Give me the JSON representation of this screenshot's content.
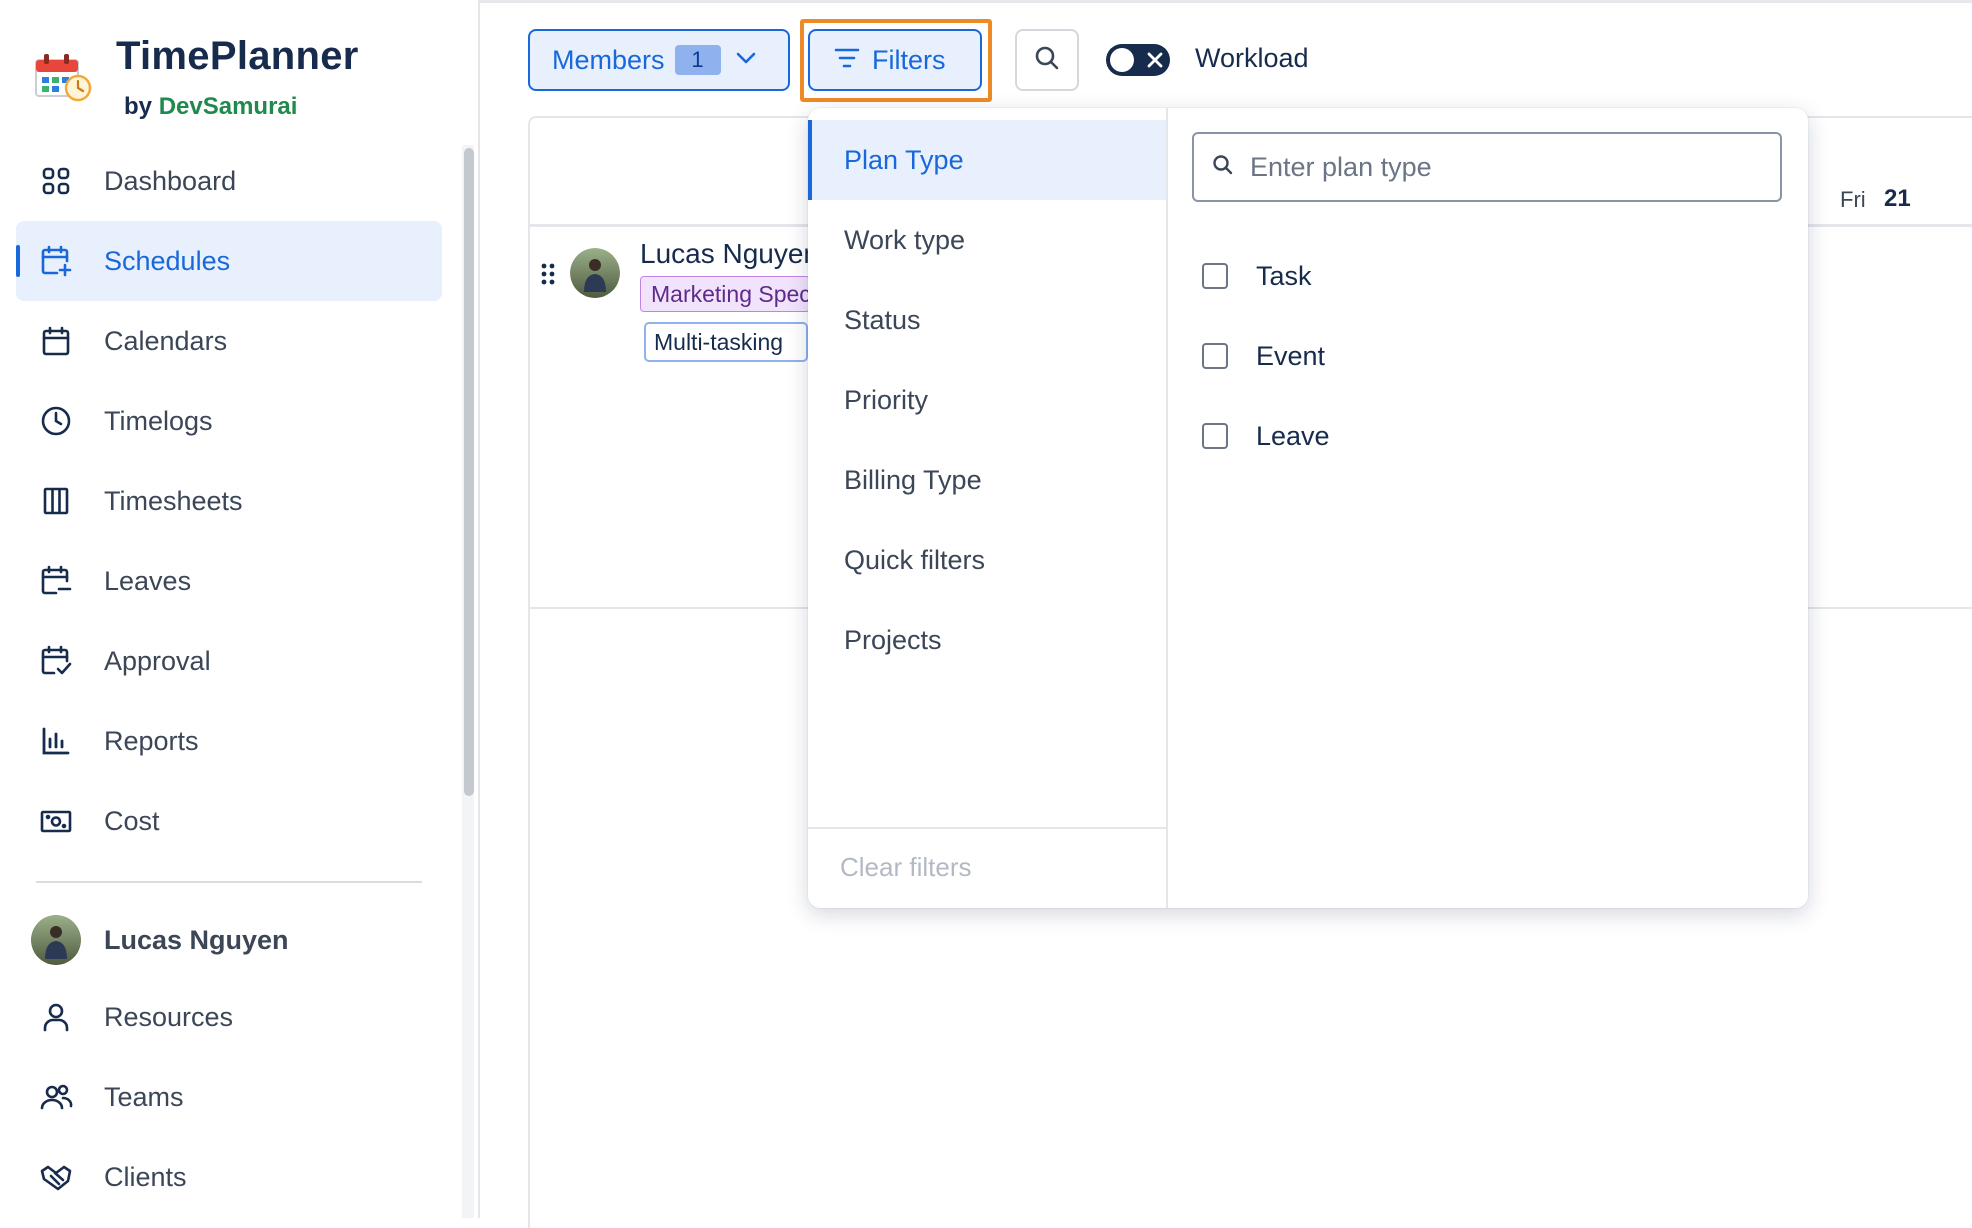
{
  "app": {
    "title": "TimePlanner",
    "by_prefix": "by",
    "brand": "DevSamurai"
  },
  "sidebar": {
    "items": [
      {
        "label": "Dashboard",
        "icon": "dashboard-icon"
      },
      {
        "label": "Schedules",
        "icon": "calendar-plus-icon",
        "active": true
      },
      {
        "label": "Calendars",
        "icon": "calendar-icon"
      },
      {
        "label": "Timelogs",
        "icon": "clock-icon"
      },
      {
        "label": "Timesheets",
        "icon": "columns-icon"
      },
      {
        "label": "Leaves",
        "icon": "calendar-minus-icon"
      },
      {
        "label": "Approval",
        "icon": "calendar-check-icon"
      },
      {
        "label": "Reports",
        "icon": "bar-chart-icon"
      },
      {
        "label": "Cost",
        "icon": "money-icon"
      }
    ],
    "user": {
      "name": "Lucas Nguyen"
    },
    "bottom_items": [
      {
        "label": "Resources",
        "icon": "person-icon"
      },
      {
        "label": "Teams",
        "icon": "team-icon"
      },
      {
        "label": "Clients",
        "icon": "handshake-icon"
      }
    ]
  },
  "toolbar": {
    "members_label": "Members",
    "members_count": "1",
    "filters_label": "Filters",
    "workload_label": "Workload",
    "workload_enabled": false
  },
  "schedule": {
    "day_label": "Fri",
    "day_number": "21",
    "member": {
      "name": "Lucas Nguyen",
      "role_tag": "Marketing Specialist",
      "skill_tag": "Multi-tasking"
    }
  },
  "filters_dropdown": {
    "categories": [
      {
        "label": "Plan Type",
        "active": true
      },
      {
        "label": "Work type"
      },
      {
        "label": "Status"
      },
      {
        "label": "Priority"
      },
      {
        "label": "Billing Type"
      },
      {
        "label": "Quick filters"
      },
      {
        "label": "Projects"
      }
    ],
    "clear_label": "Clear filters",
    "search_placeholder": "Enter plan type",
    "options": [
      {
        "label": "Task",
        "checked": false
      },
      {
        "label": "Event",
        "checked": false
      },
      {
        "label": "Leave",
        "checked": false
      }
    ]
  },
  "colors": {
    "accent": "#1868db",
    "accent_bg": "#e9f0fd",
    "highlight": "#ee8a26",
    "brand_green": "#1f8a4c"
  }
}
